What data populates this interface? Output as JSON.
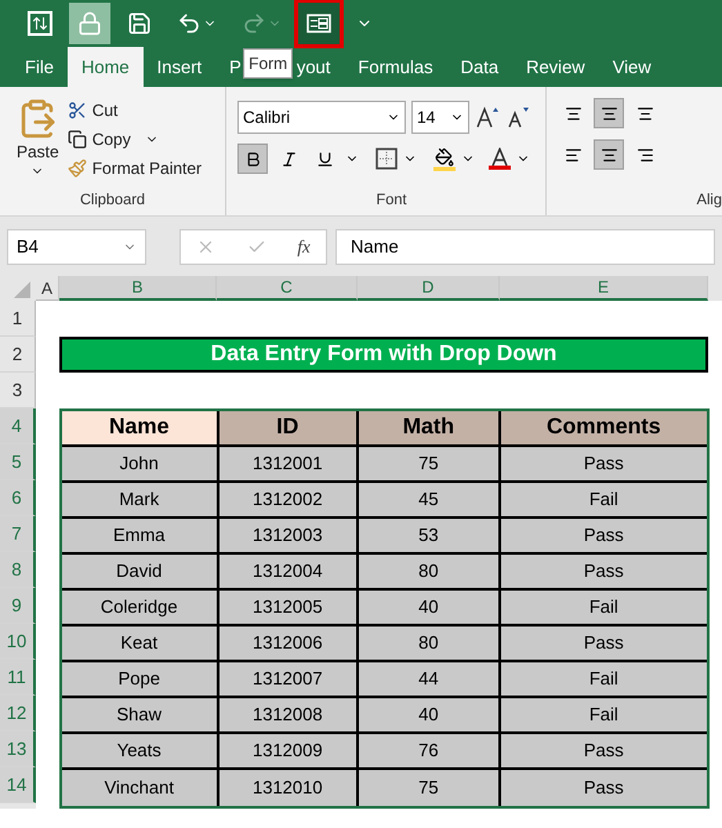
{
  "quick_access": [
    {
      "kind": "sort",
      "active": false,
      "disabled": false,
      "marked": false
    },
    {
      "kind": "lock",
      "active": true,
      "disabled": false,
      "marked": false
    },
    {
      "kind": "save",
      "active": false,
      "disabled": false,
      "marked": false
    },
    {
      "kind": "undo",
      "active": false,
      "disabled": false,
      "marked": false
    },
    {
      "kind": "redo",
      "active": false,
      "disabled": true,
      "marked": false
    },
    {
      "kind": "form",
      "active": false,
      "disabled": false,
      "marked": true
    },
    {
      "kind": "customize",
      "active": false,
      "disabled": false,
      "marked": false
    }
  ],
  "tooltip": "Form",
  "tabs": [
    {
      "label": "File",
      "selected": false
    },
    {
      "label": "Home",
      "selected": true
    },
    {
      "label": "Insert",
      "selected": false
    },
    {
      "label": "P",
      "label_after": "yout",
      "selected": false
    },
    {
      "label": "Formulas",
      "selected": false
    },
    {
      "label": "Data",
      "selected": false
    },
    {
      "label": "Review",
      "selected": false
    },
    {
      "label": "View",
      "selected": false
    }
  ],
  "clipboard": {
    "paste": "Paste",
    "cut": "Cut",
    "copy": "Copy",
    "format_painter": "Format Painter",
    "group": "Clipboard"
  },
  "font": {
    "name": "Calibri",
    "size": "14",
    "bold": true,
    "italic": false,
    "underline": false,
    "group": "Font"
  },
  "alignment": {
    "group": "Alig",
    "top": false,
    "middle": true,
    "bottom": false,
    "left": false,
    "center": true,
    "right": false
  },
  "formula_bar": {
    "name_box": "B4",
    "function_symbol": "fx",
    "value": "Name"
  },
  "columns": [
    {
      "label": "A",
      "selected": false
    },
    {
      "label": "B",
      "selected": true
    },
    {
      "label": "C",
      "selected": true
    },
    {
      "label": "D",
      "selected": true
    },
    {
      "label": "E",
      "selected": true
    }
  ],
  "row_numbers": [
    {
      "label": "1",
      "selected": false
    },
    {
      "label": "2",
      "selected": false
    },
    {
      "label": "3",
      "selected": false
    },
    {
      "label": "4",
      "selected": true
    },
    {
      "label": "5",
      "selected": true
    },
    {
      "label": "6",
      "selected": true
    },
    {
      "label": "7",
      "selected": true
    },
    {
      "label": "8",
      "selected": true
    },
    {
      "label": "9",
      "selected": true
    },
    {
      "label": "10",
      "selected": true
    },
    {
      "label": "11",
      "selected": true
    },
    {
      "label": "12",
      "selected": true
    },
    {
      "label": "13",
      "selected": true
    },
    {
      "label": "14",
      "selected": true
    }
  ],
  "sheet_title": "Data Entry Form with Drop Down",
  "table": {
    "columns": [
      "Name",
      "ID",
      "Math",
      "Comments"
    ],
    "rows": [
      [
        "John",
        "1312001",
        "75",
        "Pass"
      ],
      [
        "Mark",
        "1312002",
        "45",
        "Fail"
      ],
      [
        "Emma",
        "1312003",
        "53",
        "Pass"
      ],
      [
        "David",
        "1312004",
        "80",
        "Pass"
      ],
      [
        "Coleridge",
        "1312005",
        "40",
        "Fail"
      ],
      [
        "Keat",
        "1312006",
        "80",
        "Pass"
      ],
      [
        "Pope",
        "1312007",
        "44",
        "Fail"
      ],
      [
        "Shaw",
        "1312008",
        "40",
        "Fail"
      ],
      [
        "Yeats",
        "1312009",
        "76",
        "Pass"
      ],
      [
        "Vinchant",
        "1312010",
        "75",
        "Pass"
      ]
    ]
  }
}
